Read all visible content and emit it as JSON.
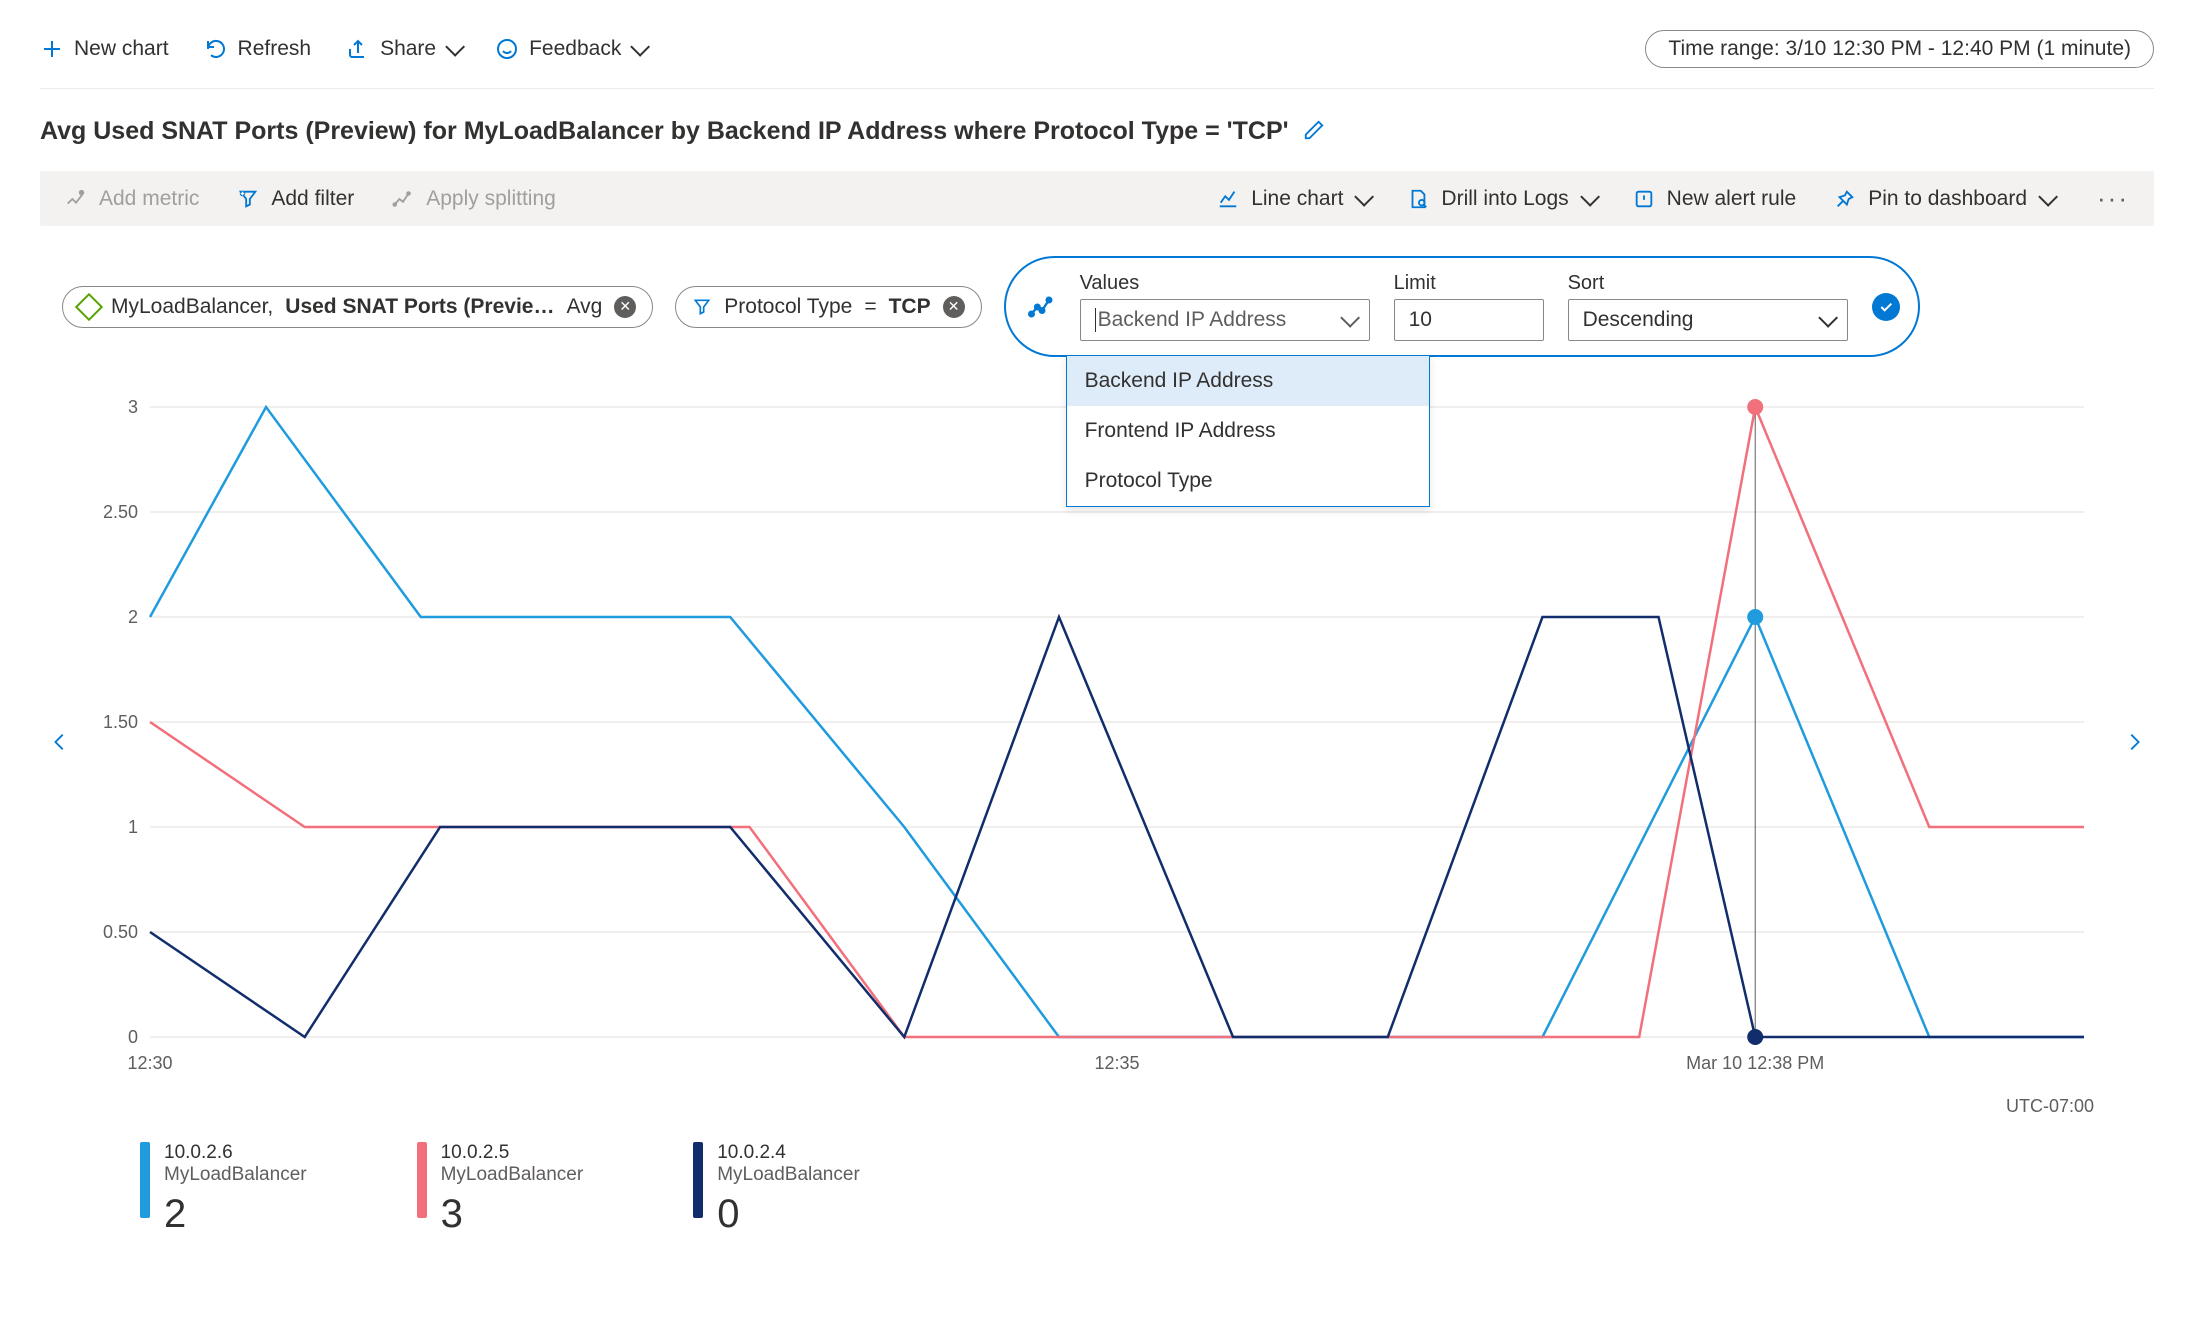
{
  "toolbar": {
    "new_chart": "New chart",
    "refresh": "Refresh",
    "share": "Share",
    "feedback": "Feedback",
    "time_range": "Time range: 3/10 12:30 PM - 12:40 PM (1 minute)"
  },
  "title": "Avg Used SNAT Ports (Preview) for MyLoadBalancer by Backend IP Address where Protocol Type = 'TCP'",
  "subtoolbar": {
    "add_metric": "Add metric",
    "add_filter": "Add filter",
    "apply_splitting": "Apply splitting",
    "chart_type": "Line chart",
    "drill_logs": "Drill into Logs",
    "new_alert": "New alert rule",
    "pin": "Pin to dashboard"
  },
  "pills": {
    "metric": {
      "resource": "MyLoadBalancer,",
      "metric": "Used SNAT Ports (Previe…",
      "agg": "Avg"
    },
    "filter": {
      "dim": "Protocol Type",
      "op": "=",
      "val": "TCP"
    }
  },
  "split": {
    "values_label": "Values",
    "values_selected": "Backend IP Address",
    "limit_label": "Limit",
    "limit_value": "10",
    "sort_label": "Sort",
    "sort_value": "Descending",
    "options": [
      "Backend IP Address",
      "Frontend IP Address",
      "Protocol Type"
    ]
  },
  "chart_data": {
    "type": "line",
    "ylim": [
      0,
      3
    ],
    "y_ticks": [
      "0",
      "0.50",
      "1",
      "1.50",
      "2",
      "2.50",
      "3"
    ],
    "x_ticks": [
      {
        "pos": 0.0,
        "label": "12:30"
      },
      {
        "pos": 0.5,
        "label": "12:35"
      },
      {
        "pos": 0.83,
        "label": "Mar 10 12:38 PM"
      }
    ],
    "utc": "UTC-07:00",
    "hover_x": 0.83,
    "series": [
      {
        "name": "10.0.2.6",
        "resource": "MyLoadBalancer",
        "color": "#1f9bde",
        "current": "2",
        "points": [
          [
            0.0,
            2
          ],
          [
            0.06,
            3
          ],
          [
            0.14,
            2
          ],
          [
            0.22,
            2
          ],
          [
            0.3,
            2
          ],
          [
            0.39,
            1
          ],
          [
            0.47,
            0
          ],
          [
            0.56,
            0
          ],
          [
            0.64,
            0
          ],
          [
            0.72,
            0
          ],
          [
            0.83,
            2
          ],
          [
            0.92,
            0
          ],
          [
            1.0,
            0
          ]
        ]
      },
      {
        "name": "10.0.2.5",
        "resource": "MyLoadBalancer",
        "color": "#f1707b",
        "current": "3",
        "points": [
          [
            0.0,
            1.5
          ],
          [
            0.08,
            1
          ],
          [
            0.15,
            1
          ],
          [
            0.23,
            1
          ],
          [
            0.31,
            1
          ],
          [
            0.39,
            0
          ],
          [
            0.47,
            0
          ],
          [
            0.56,
            0
          ],
          [
            0.64,
            0
          ],
          [
            0.72,
            0
          ],
          [
            0.77,
            0
          ],
          [
            0.83,
            3
          ],
          [
            0.92,
            1
          ],
          [
            1.0,
            1
          ]
        ]
      },
      {
        "name": "10.0.2.4",
        "resource": "MyLoadBalancer",
        "color": "#112d6b",
        "current": "0",
        "points": [
          [
            0.0,
            0.5
          ],
          [
            0.08,
            0
          ],
          [
            0.15,
            1
          ],
          [
            0.22,
            1
          ],
          [
            0.3,
            1
          ],
          [
            0.39,
            0
          ],
          [
            0.47,
            2
          ],
          [
            0.56,
            0
          ],
          [
            0.64,
            0
          ],
          [
            0.72,
            2
          ],
          [
            0.78,
            2
          ],
          [
            0.83,
            0
          ],
          [
            0.92,
            0
          ],
          [
            1.0,
            0
          ]
        ]
      }
    ]
  },
  "colors": {
    "accent": "#0078d4"
  }
}
